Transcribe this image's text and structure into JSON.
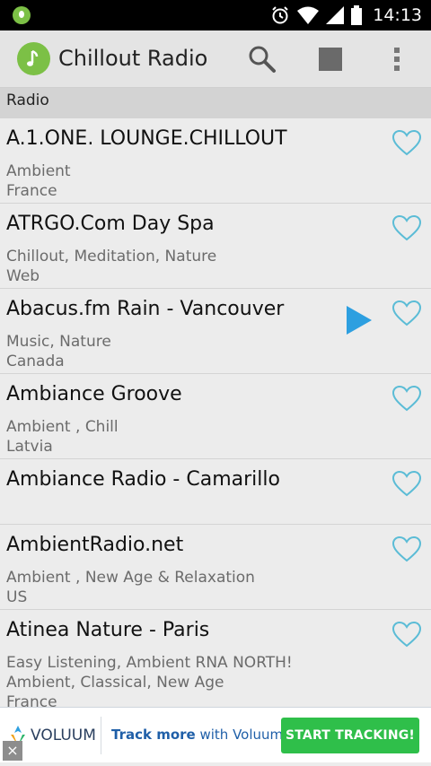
{
  "status_bar": {
    "time": "14:13"
  },
  "app_bar": {
    "title": "Chillout Radio"
  },
  "section": {
    "label": "Radio"
  },
  "stations": [
    {
      "name": "A.1.ONE. LOUNGE.CHILLOUT",
      "genre": "Ambient",
      "country": "France",
      "playing": false
    },
    {
      "name": "ATRGO.Com Day Spa",
      "genre": "Chillout, Meditation, Nature",
      "country": "Web",
      "playing": false
    },
    {
      "name": "Abacus.fm Rain - Vancouver",
      "genre": "Music, Nature",
      "country": "Canada",
      "playing": true
    },
    {
      "name": "Ambiance Groove",
      "genre": "Ambient , Chill",
      "country": "Latvia",
      "playing": false
    },
    {
      "name": "Ambiance Radio - Camarillo",
      "genre": "",
      "country": "",
      "playing": false
    },
    {
      "name": "AmbientRadio.net",
      "genre": "Ambient , New Age & Relaxation",
      "country": "US",
      "playing": false
    },
    {
      "name": "Atinea Nature - Paris",
      "genre": "Easy Listening, Ambient RNA NORTH!",
      "genre_line2": "Ambient, Classical, New Age",
      "country": "France",
      "playing": false
    }
  ],
  "ad": {
    "brand": "VOLUUM",
    "text_prefix": "Track more",
    "text_suffix": " with Voluum!",
    "cta": "START TRACKING!",
    "close_icon": "×"
  },
  "colors": {
    "accent": "#7cc046",
    "heart": "#5bbcd6",
    "play": "#2d9fe0",
    "cta": "#2fbf4a"
  }
}
